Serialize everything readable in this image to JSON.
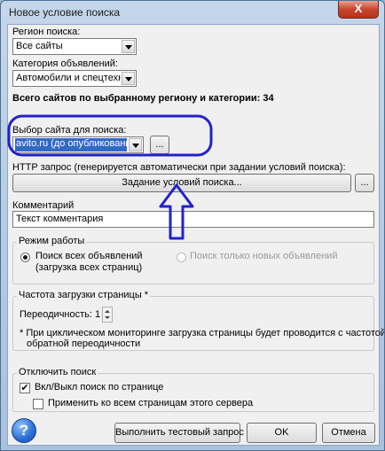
{
  "window": {
    "title": "Новое условие поиска",
    "close_glyph": "X"
  },
  "region": {
    "label": "Регион поиска:",
    "value": "Все сайты"
  },
  "category": {
    "label": "Категория объявлений:",
    "value": "Автомобили и спецтехника"
  },
  "summary": {
    "text": "Всего сайтов по выбранному региону и категории: 34"
  },
  "site": {
    "label": "Выбор сайта для поиска:",
    "value": "avito.ru (до опубликования)",
    "more_label": "..."
  },
  "http": {
    "label": "HTTP запрос (генерируется автоматически при задании условий поиска):",
    "button_label": "Задание условий поиска...",
    "more_label": "..."
  },
  "comment": {
    "label": "Комментарий",
    "value": "Текст комментария"
  },
  "mode": {
    "title": "Режим работы",
    "option_all_line1": "Поиск всех объявлений",
    "option_all_line2": "(загрузка всех страниц)",
    "option_new": "Поиск только новых объявлений",
    "selected": "all"
  },
  "frequency": {
    "title": "Частота загрузки страницы *",
    "period_label": "Переодичность: 1",
    "note_line1": "* При циклическом мониторинге загрузка страницы будет проводится с частотой,",
    "note_line2": "обратной переодичности"
  },
  "disable": {
    "title": "Отключить поиск",
    "toggle_label": "Вкл/Выкл поиск по странице",
    "toggle_checked": true,
    "apply_all_label": "Применить ко всем страницам этого сервера",
    "apply_all_checked": false
  },
  "footer": {
    "help_glyph": "?",
    "test_label": "Выполнить тестовый запрос",
    "ok_label": "OK",
    "cancel_label": "Отмена"
  },
  "colors": {
    "highlight": "#2222cc",
    "selection": "#3169c6"
  }
}
